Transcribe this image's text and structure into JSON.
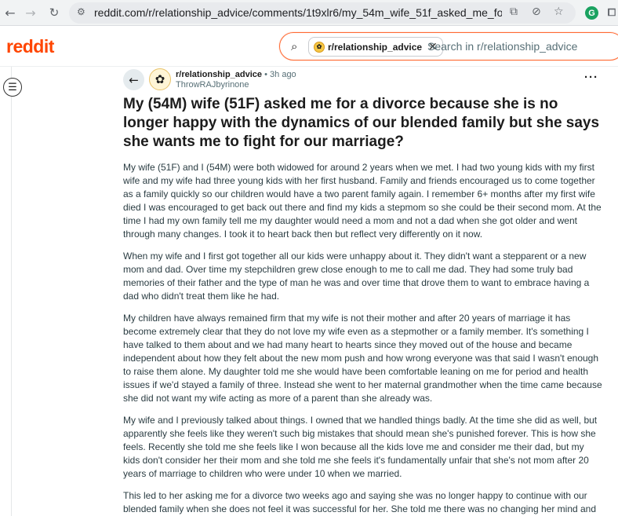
{
  "browser": {
    "url": "reddit.com/r/relationship_advice/comments/1t9xlr6/my_54m_wife_51f_asked_me_for_a_div..."
  },
  "header": {
    "logo": "reddit",
    "search": {
      "chip_label": "r/relationship_advice",
      "placeholder": "Search in r/relationship_advice"
    }
  },
  "post": {
    "subreddit": "r/relationship_advice",
    "separator": "•",
    "time": "3h ago",
    "author": "ThrowRAJbyrinone",
    "title": "My (54M) wife (51F) asked me for a divorce because she is no longer happy with the dynamics of our blended family but she says she wants me to fight for our marriage?",
    "paragraphs": [
      "My wife (51F) and I (54M) were both widowed for around 2 years when we met. I had two young kids with my first wife and my wife had three young kids with her first husband. Family and friends encouraged us to come together as a family quickly so our children would have a two parent family again. I remember 6+ months after my first wife died I was encouraged to get back out there and find my kids a stepmom so she could be their second mom. At the time I had my own family tell me my daughter would need a mom and not a dad when she got older and went through many changes. I took it to heart back then but reflect very differently on it now.",
      "When my wife and I first got together all our kids were unhappy about it. They didn't want a stepparent or a new mom and dad. Over time my stepchildren grew close enough to me to call me dad. They had some truly bad memories of their father and the type of man he was and over time that drove them to want to embrace having a dad who didn't treat them like he had.",
      "My children have always remained firm that my wife is not their mother and after 20 years of marriage it has become extremely clear that they do not love my wife even as a stepmother or a family member. It's something I have talked to them about and we had many heart to hearts since they moved out of the house and became independent about how they felt about the new mom push and how wrong everyone was that said I wasn't enough to raise them alone. My daughter told me she would have been comfortable leaning on me for period and health issues if we'd stayed a family of three. Instead she went to her maternal grandmother when the time came because she did not want my wife acting as more of a parent than she already was.",
      "My wife and I previously talked about things. I owned that we handled things badly. At the time she did as well, but apparently she feels like they weren't such big mistakes that should mean she's punished forever. This is how she feels. Recently she told me she feels like I won because all the kids love me and consider me their dad, but my kids don't consider her their mom and she told me she feels it's fundamentally unfair that she's not mom after 20 years of marriage to children who were under 10 when we married.",
      "This led to her asking me for a divorce two weeks ago and saying she was no longer happy to continue with our blended family when she does not feel it was successful for her. She told me there was no changing her mind and"
    ]
  }
}
